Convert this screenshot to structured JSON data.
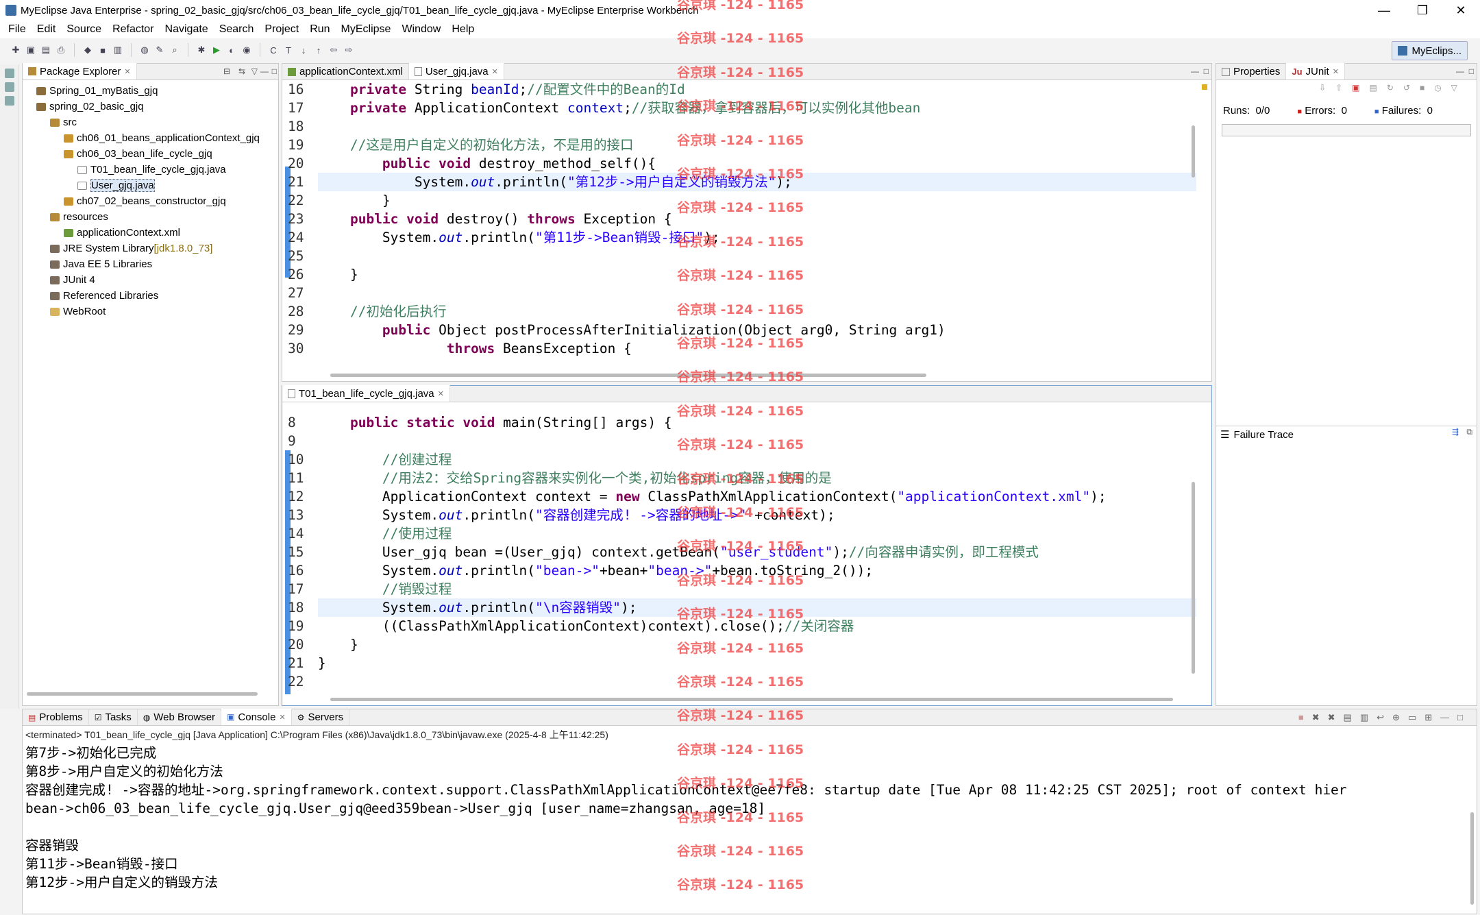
{
  "window": {
    "title": "MyEclipse Java Enterprise - spring_02_basic_gjq/src/ch06_03_bean_life_cycle_gjq/T01_bean_life_cycle_gjq.java - MyEclipse Enterprise Workbench",
    "minimize": "—",
    "maximize": "❐",
    "close": "✕"
  },
  "menu": [
    "File",
    "Edit",
    "Source",
    "Refactor",
    "Navigate",
    "Search",
    "Project",
    "Run",
    "MyEclipse",
    "Window",
    "Help"
  ],
  "perspective": {
    "label": "MyEclips..."
  },
  "package_explorer": {
    "tab": "Package Explorer",
    "tree": [
      {
        "label": "Spring_01_myBatis_gjq",
        "indent": 0,
        "icon": "project-icon"
      },
      {
        "label": "spring_02_basic_gjq",
        "indent": 0,
        "icon": "project-icon"
      },
      {
        "label": "src",
        "indent": 1,
        "icon": "source-folder-icon"
      },
      {
        "label": "ch06_01_beans_applicationContext_gjq",
        "indent": 2,
        "icon": "package-icon"
      },
      {
        "label": "ch06_03_bean_life_cycle_gjq",
        "indent": 2,
        "icon": "package-icon"
      },
      {
        "label": "T01_bean_life_cycle_gjq.java",
        "indent": 3,
        "icon": "java-file-icon"
      },
      {
        "label": "User_gjq.java",
        "indent": 3,
        "icon": "java-file-icon",
        "selected": true
      },
      {
        "label": "ch07_02_beans_constructor_gjq",
        "indent": 2,
        "icon": "package-icon"
      },
      {
        "label": "resources",
        "indent": 1,
        "icon": "source-folder-icon"
      },
      {
        "label": "applicationContext.xml",
        "indent": 2,
        "icon": "xml-file-icon"
      },
      {
        "label": "JRE System Library",
        "deco": "[jdk1.8.0_73]",
        "indent": 1,
        "icon": "library-icon"
      },
      {
        "label": "Java EE 5 Libraries",
        "indent": 1,
        "icon": "library-icon"
      },
      {
        "label": "JUnit 4",
        "indent": 1,
        "icon": "library-icon"
      },
      {
        "label": "Referenced Libraries",
        "indent": 1,
        "icon": "library-icon"
      },
      {
        "label": "WebRoot",
        "indent": 1,
        "icon": "folder-icon"
      }
    ]
  },
  "editor_top": {
    "tabs": [
      "applicationContext.xml",
      "User_gjq.java"
    ],
    "active_tab": 1,
    "lines": [
      {
        "n": "16",
        "html": "    <span class=\"kw\">private</span> String <span class=\"fi\">beanId</span>;<span class=\"cm\">//配置文件中的Bean的Id</span>"
      },
      {
        "n": "17",
        "html": "    <span class=\"kw\">private</span> ApplicationContext <span class=\"fi\">context</span>;<span class=\"cm\">//获取容器，拿到容器后，可以实例化其他bean</span>"
      },
      {
        "n": "18",
        "html": ""
      },
      {
        "n": "19",
        "html": "    <span class=\"cm\">//这是用户自定义的初始化方法，不是用的接口</span>"
      },
      {
        "n": "20",
        "html": "        <span class=\"kw\">public</span> <span class=\"kw\">void</span> destroy_method_self(){"
      },
      {
        "n": "21",
        "html": "            System.<span class=\"it\">out</span>.println(<span class=\"st\">\"第12步->用户自定义的销毁方法\"</span>);",
        "hl": true
      },
      {
        "n": "22",
        "html": "        }"
      },
      {
        "n": "23",
        "html": "    <span class=\"kw\">public</span> <span class=\"kw\">void</span> destroy() <span class=\"kw\">throws</span> Exception {"
      },
      {
        "n": "24",
        "html": "        System.<span class=\"it\">out</span>.println(<span class=\"st\">\"第11步->Bean销毁-接口\"</span>);"
      },
      {
        "n": "25",
        "html": ""
      },
      {
        "n": "26",
        "html": "    }"
      },
      {
        "n": "27",
        "html": ""
      },
      {
        "n": "28",
        "html": "    <span class=\"cm\">//初始化后执行</span>"
      },
      {
        "n": "29",
        "html": "        <span class=\"kw\">public</span> Object postProcessAfterInitialization(Object arg0, String arg1)"
      },
      {
        "n": "30",
        "html": "                <span class=\"kw\">throws</span> BeansException {"
      }
    ]
  },
  "editor_bottom": {
    "tabs": [
      "T01_bean_life_cycle_gjq.java"
    ],
    "lines": [
      {
        "n": "8",
        "html": "    <span class=\"kw\">public</span> <span class=\"kw\">static</span> <span class=\"kw\">void</span> main(String[] args) {"
      },
      {
        "n": "9",
        "html": ""
      },
      {
        "n": "10",
        "html": "        <span class=\"cm\">//创建过程</span>"
      },
      {
        "n": "11",
        "html": "        <span class=\"cm\">//用法2：交给Spring容器来实例化一个类,初始化spring容器，使用的是</span>"
      },
      {
        "n": "12",
        "html": "        ApplicationContext context = <span class=\"kw\">new</span> ClassPathXmlApplicationContext(<span class=\"st\">\"applicationContext.xml\"</span>);"
      },
      {
        "n": "13",
        "html": "        System.<span class=\"it\">out</span>.println(<span class=\"st\">\"容器创建完成! ->容器的地址->\"</span> +context);"
      },
      {
        "n": "14",
        "html": "        <span class=\"cm\">//使用过程</span>"
      },
      {
        "n": "15",
        "html": "        User_gjq bean =(User_gjq) context.getBean(<span class=\"st\">\"user_student\"</span>);<span class=\"cm\">//向容器申请实例，即工程模式</span>"
      },
      {
        "n": "16",
        "html": "        System.<span class=\"it\">out</span>.println(<span class=\"st\">\"bean->\"</span>+bean+<span class=\"st\">\"bean->\"</span>+bean.toString_2());"
      },
      {
        "n": "17",
        "html": "        <span class=\"cm\">//销毁过程</span>"
      },
      {
        "n": "18",
        "html": "        System.<span class=\"it\">out</span>.println(<span class=\"st\">\"\\n容器销毁\"</span>);",
        "hl": true
      },
      {
        "n": "19",
        "html": "        ((ClassPathXmlApplicationContext)context).close();<span class=\"cm\">//关闭容器</span>"
      },
      {
        "n": "20",
        "html": "    }"
      },
      {
        "n": "21",
        "html": "}"
      },
      {
        "n": "22",
        "html": ""
      }
    ]
  },
  "junit": {
    "tabs": [
      "Properties",
      "JUnit"
    ],
    "runs_label": "Runs:",
    "runs": "0/0",
    "errors_label": "Errors:",
    "errors": "0",
    "failures_label": "Failures:",
    "failures": "0",
    "failure_trace": "Failure Trace"
  },
  "console": {
    "tabs": [
      "Problems",
      "Tasks",
      "Web Browser",
      "Console",
      "Servers"
    ],
    "header": "<terminated> T01_bean_life_cycle_gjq [Java Application] C:\\Program Files (x86)\\Java\\jdk1.8.0_73\\bin\\javaw.exe (2025-4-8 上午11:42:25)",
    "lines": [
      "第7步->初始化已完成",
      "第8步->用户自定义的初始化方法",
      "容器创建完成! ->容器的地址->org.springframework.context.support.ClassPathXmlApplicationContext@ee7fe8: startup date [Tue Apr 08 11:42:25 CST 2025]; root of context hier",
      "bean->ch06_03_bean_life_cycle_gjq.User_gjq@eed359bean->User_gjq [user_name=zhangsan, age=18]",
      "",
      "容器销毁",
      "第11步->Bean销毁-接口",
      "第12步->用户自定义的销毁方法"
    ]
  },
  "watermark": "谷京琪 -124 - 1165"
}
